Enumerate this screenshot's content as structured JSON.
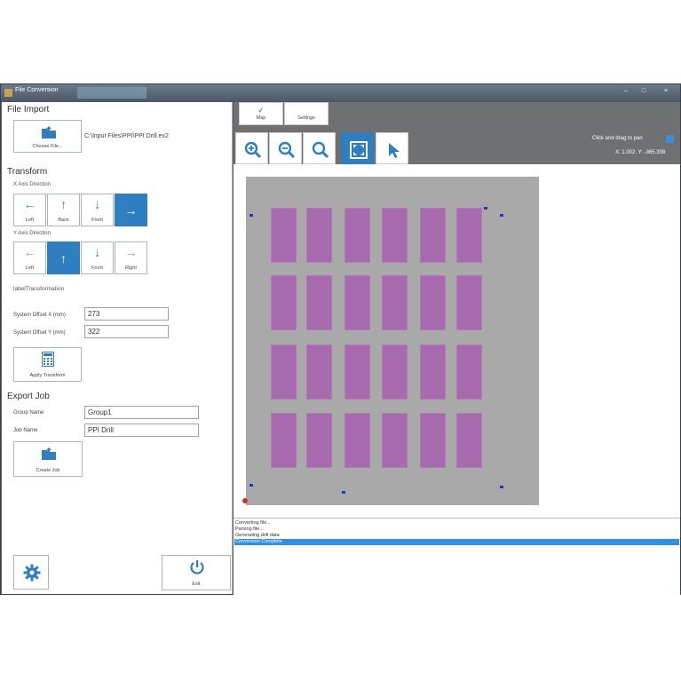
{
  "window": {
    "title": "File Conversion"
  },
  "file_import": {
    "heading": "File Import",
    "choose_label": "Choose File...",
    "path": "C:\\Input Files\\PPI\\PPI Drill.ex2"
  },
  "transform": {
    "heading": "Transform",
    "x_axis_label": "X Axis Direction",
    "x_buttons": [
      {
        "label": "Left",
        "arrow": "←"
      },
      {
        "label": "Back",
        "arrow": "↑"
      },
      {
        "label": "Front",
        "arrow": "↓"
      },
      {
        "label": "",
        "arrow": "→"
      }
    ],
    "y_axis_label": "Y Axis Direction",
    "y_buttons": [
      {
        "label": "Left",
        "arrow": "←"
      },
      {
        "label": "",
        "arrow": "↑"
      },
      {
        "label": "Front",
        "arrow": "↓"
      },
      {
        "label": "Right",
        "arrow": "→"
      }
    ],
    "label_transformation": "labelTransformation",
    "offset_x_label": "System Offset X (mm)",
    "offset_x_value": "273",
    "offset_y_label": "System Offset Y (mm)",
    "offset_y_value": "322",
    "apply_label": "Apply Transform"
  },
  "export_job": {
    "heading": "Export Job",
    "group_label": "Group Name",
    "group_value": "Group1",
    "job_label": "Job Name",
    "job_value": "PPI Drill",
    "create_label": "Create Job"
  },
  "footer": {
    "exit_label": "Exit"
  },
  "toolbar": {
    "map_label": "Map",
    "settings_label": "Settings",
    "hint": "Click and drag to pan",
    "coords": "X: 1.002, Y: -365.308"
  },
  "log": [
    {
      "text": "Converting file...",
      "selected": false
    },
    {
      "text": "Parsing file...",
      "selected": false
    },
    {
      "text": "Generating drill data",
      "selected": false
    },
    {
      "text": "Conversion Complete",
      "selected": true
    }
  ],
  "colors": {
    "accent": "#2f7fc0",
    "panel": "#a86aae",
    "board": "#a9a9a9"
  }
}
